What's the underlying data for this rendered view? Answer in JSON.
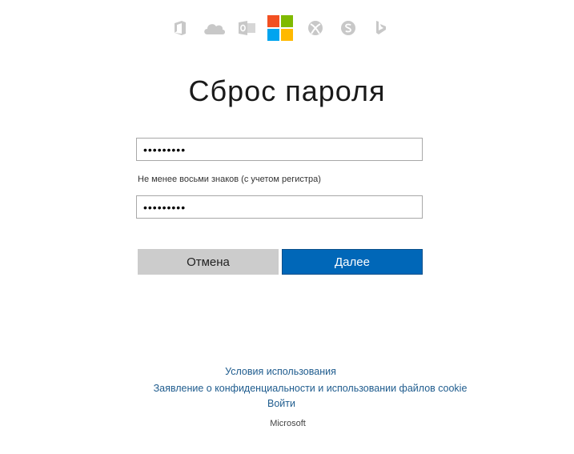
{
  "header": {
    "product_icons": [
      "office-icon",
      "onedrive-icon",
      "outlook-icon",
      "microsoft-logo-icon",
      "xbox-icon",
      "skype-icon",
      "bing-icon"
    ],
    "logo_colors": {
      "red": "#f25022",
      "green": "#7fba00",
      "blue": "#00a4ef",
      "yellow": "#ffb900"
    },
    "icon_color": "#c8c8c8"
  },
  "main": {
    "title": "Сброс пароля",
    "new_password": {
      "value": "•••••••••"
    },
    "hint": "Не менее восьми знаков (с учетом регистра)",
    "confirm_password": {
      "value": "•••••••••"
    },
    "buttons": {
      "cancel": "Отмена",
      "next": "Далее"
    },
    "colors": {
      "primary": "#0067b8",
      "secondary": "#cccccc"
    }
  },
  "footer": {
    "terms": "Условия использования",
    "privacy": "Заявление о конфиденциальности и использовании файлов cookie",
    "signin": "Войти",
    "brand": "Microsoft",
    "link_color": "#1f5c8e"
  }
}
